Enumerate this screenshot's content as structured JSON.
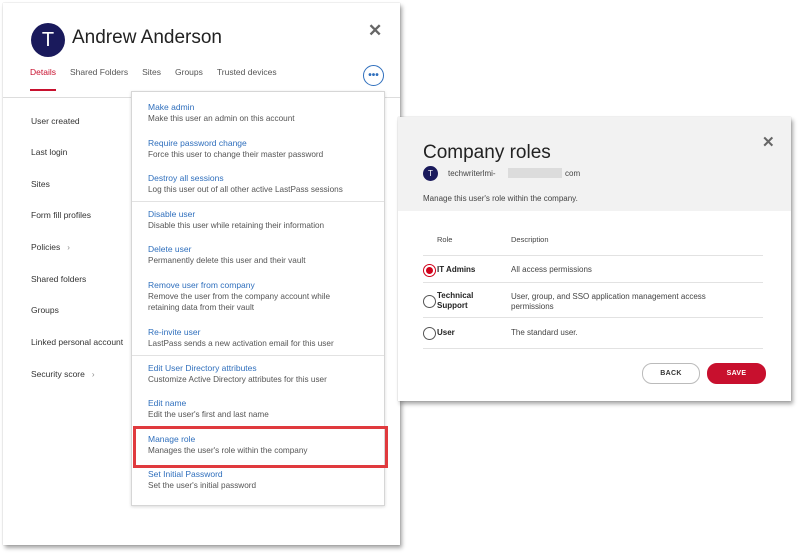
{
  "user": {
    "initial": "T",
    "name": "Andrew Anderson",
    "close_icon": "✕",
    "more_icon": "•••",
    "tabs": [
      "Details",
      "Shared Folders",
      "Sites",
      "Groups",
      "Trusted devices"
    ],
    "details": [
      "User created",
      "Last login",
      "Sites",
      "Form fill profiles",
      "Policies",
      "Shared folders",
      "Groups",
      "Linked personal account",
      "Security score"
    ],
    "chevron": "›"
  },
  "menu": {
    "items": [
      {
        "title": "Make admin",
        "desc": "Make this user an admin on this account"
      },
      {
        "title": "Require password change",
        "desc": "Force this user to change their master password"
      },
      {
        "title": "Destroy all sessions",
        "desc": "Log this user out of all other active LastPass sessions"
      },
      {
        "title": "Disable user",
        "desc": "Disable this user while retaining their information"
      },
      {
        "title": "Delete user",
        "desc": "Permanently delete this user and their vault"
      },
      {
        "title": "Remove user from company",
        "desc": "Remove the user from the company account while",
        "desc2": "retaining data from their vault"
      },
      {
        "title": "Re-invite user",
        "desc": "LastPass sends a new activation email for this user"
      },
      {
        "title": "Edit User Directory attributes",
        "desc": "Customize Active Directory attributes for this user"
      },
      {
        "title": "Edit name",
        "desc": "Edit the user's first and last name"
      },
      {
        "title": "Manage role",
        "desc": "Manages the user's role within the company"
      },
      {
        "title": "Set Initial Password",
        "desc": "Set the user's initial password"
      }
    ]
  },
  "roles": {
    "title": "Company roles",
    "initial": "T",
    "email_start": "techwriterlmi-",
    "email_end": "com",
    "subtitle": "Manage this user's role within the company.",
    "col_role": "Role",
    "col_desc": "Description",
    "options": [
      {
        "name": "IT Admins",
        "desc": "All access permissions",
        "selected": true
      },
      {
        "name": "Technical Support",
        "desc": "User, group, and SSO application management access permissions",
        "selected": false
      },
      {
        "name": "User",
        "desc": "The standard user.",
        "selected": false
      }
    ],
    "back_label": "BACK",
    "save_label": "SAVE",
    "colors": {
      "accent": "#c8102e",
      "link": "#2f6fbd",
      "avatar": "#1a1a5c"
    }
  }
}
